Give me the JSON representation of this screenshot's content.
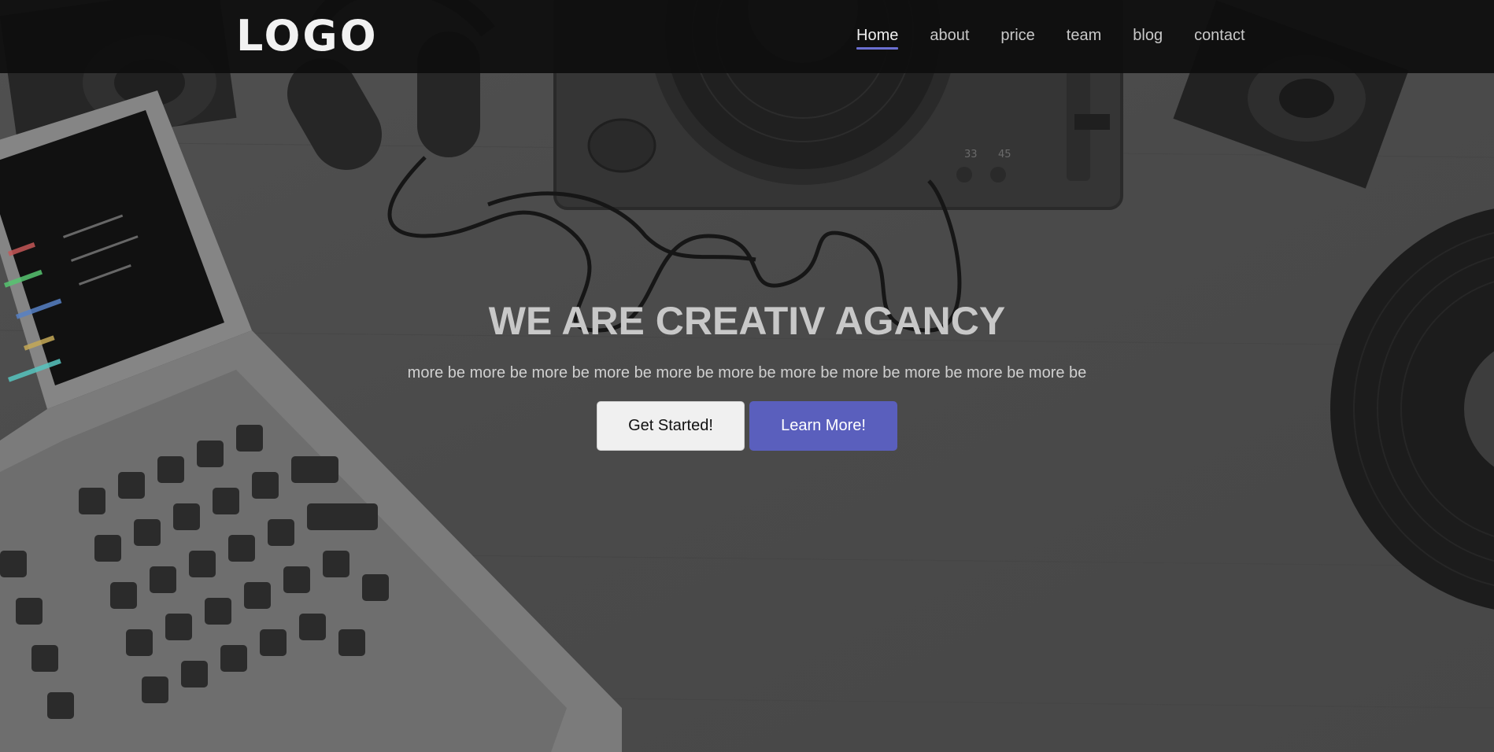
{
  "brand": {
    "logo_text": "LOGO"
  },
  "nav": {
    "items": [
      {
        "label": "Home",
        "active": true
      },
      {
        "label": "about"
      },
      {
        "label": "price"
      },
      {
        "label": "team"
      },
      {
        "label": "blog"
      },
      {
        "label": "contact"
      }
    ]
  },
  "hero": {
    "title": "WE ARE CREATIV AGANCY",
    "subtitle": "more be more be more be more be more be more be more be more be more be more be more be",
    "primary_button": "Get Started!",
    "secondary_button": "Learn More!"
  },
  "colors": {
    "accent": "#5a5fbd",
    "nav_underline": "#6b6fd1",
    "navbar_bg": "#0e0e0e"
  }
}
